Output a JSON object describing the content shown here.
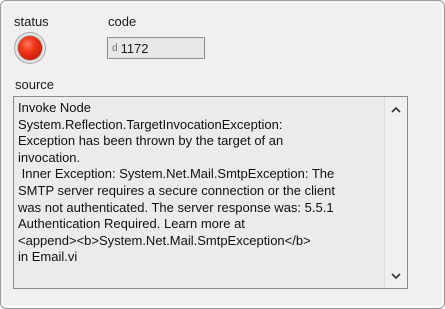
{
  "labels": {
    "status": "status",
    "code": "code",
    "source": "source"
  },
  "status_led": {
    "state": "on",
    "color": "#e8321a"
  },
  "code_field": {
    "radix": "d",
    "value": "1172"
  },
  "source_text": "Invoke Node\nSystem.Reflection.TargetInvocationException:\nException has been thrown by the target of an\ninvocation.\n Inner Exception: System.Net.Mail.SmtpException: The\nSMTP server requires a secure connection or the client\nwas not authenticated. The server response was: 5.5.1\nAuthentication Required. Learn more at\n<append><b>System.Net.Mail.SmtpException</b>\nin Email.vi",
  "icons": {
    "scroll_up": "chevron-up-icon",
    "scroll_down": "chevron-down-icon"
  }
}
